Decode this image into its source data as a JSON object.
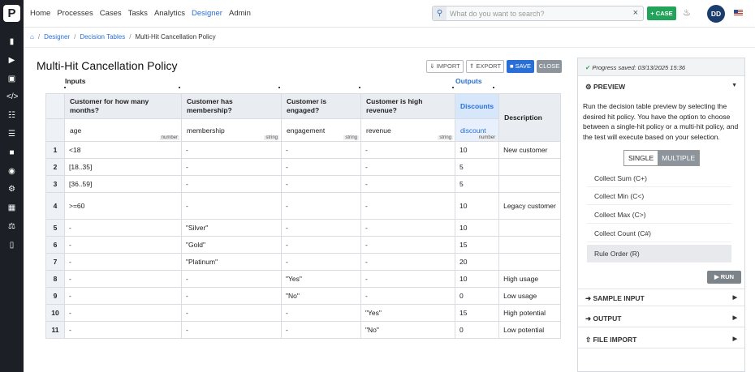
{
  "topbar": {
    "logo": "P",
    "nav": [
      "Home",
      "Processes",
      "Cases",
      "Tasks",
      "Analytics",
      "Designer",
      "Admin"
    ],
    "active_nav": "Designer",
    "search_placeholder": "What do you want to search?",
    "case_label": "+ CASE",
    "avatar": "DD"
  },
  "breadcrumb": {
    "items": [
      "Designer",
      "Decision Tables",
      "Multi-Hit Cancellation Policy"
    ]
  },
  "page": {
    "title": "Multi-Hit Cancellation Policy",
    "buttons": {
      "import": "IMPORT",
      "export": "EXPORT",
      "save": "SAVE",
      "close": "CLOSE"
    }
  },
  "table": {
    "inputs_label": "Inputs",
    "outputs_label": "Outputs",
    "columns": [
      {
        "header": "Customer for how many months?",
        "var": "age",
        "type": "number"
      },
      {
        "header": "Customer has membership?",
        "var": "membership",
        "type": "string"
      },
      {
        "header": "Customer is engaged?",
        "var": "engagement",
        "type": "string"
      },
      {
        "header": "Customer is high revenue?",
        "var": "revenue",
        "type": "string"
      },
      {
        "header": "Discounts",
        "var": "discount",
        "type": "number"
      },
      {
        "header": "Description"
      }
    ],
    "rows": [
      [
        "1",
        "<18",
        "-",
        "-",
        "-",
        "10",
        "New customer"
      ],
      [
        "2",
        "[18..35]",
        "-",
        "-",
        "-",
        "5",
        ""
      ],
      [
        "3",
        "[36..59]",
        "-",
        "-",
        "-",
        "5",
        ""
      ],
      [
        "4",
        ">=60",
        "-",
        "-",
        "-",
        "10",
        "Legacy customer"
      ],
      [
        "5",
        "-",
        "\"Silver\"",
        "-",
        "-",
        "10",
        ""
      ],
      [
        "6",
        "-",
        "\"Gold\"",
        "-",
        "-",
        "15",
        ""
      ],
      [
        "7",
        "-",
        "\"Platinum\"",
        "-",
        "-",
        "20",
        ""
      ],
      [
        "8",
        "-",
        "-",
        "\"Yes\"",
        "-",
        "10",
        "High usage"
      ],
      [
        "9",
        "-",
        "-",
        "\"No\"",
        "-",
        "0",
        "Low usage"
      ],
      [
        "10",
        "-",
        "-",
        "-",
        "\"Yes\"",
        "15",
        "High potential"
      ],
      [
        "11",
        "-",
        "-",
        "-",
        "\"No\"",
        "0",
        "Low potential"
      ]
    ]
  },
  "panel": {
    "saved": "Progress saved: 03/13/2025 15:36",
    "preview": "PREVIEW",
    "description": "Run the decision table preview by selecting the desired hit policy. You have the option to choose between a single-hit policy or a multi-hit policy, and the test will execute based on your selection.",
    "toggle": {
      "single": "SINGLE",
      "multiple": "MULTIPLE"
    },
    "policies": [
      "Collect Sum (C+)",
      "Collect Min (C<)",
      "Collect Max (C>)",
      "Collect Count (C#)",
      "Rule Order (R)"
    ],
    "selected_policy": "Rule Order (R)",
    "run": "RUN",
    "sections": [
      "SAMPLE INPUT",
      "OUTPUT",
      "FILE IMPORT"
    ]
  },
  "colors": {
    "accent": "#2a6fd6",
    "sidebar": "#1c1f26",
    "case_green": "#21a35a"
  }
}
